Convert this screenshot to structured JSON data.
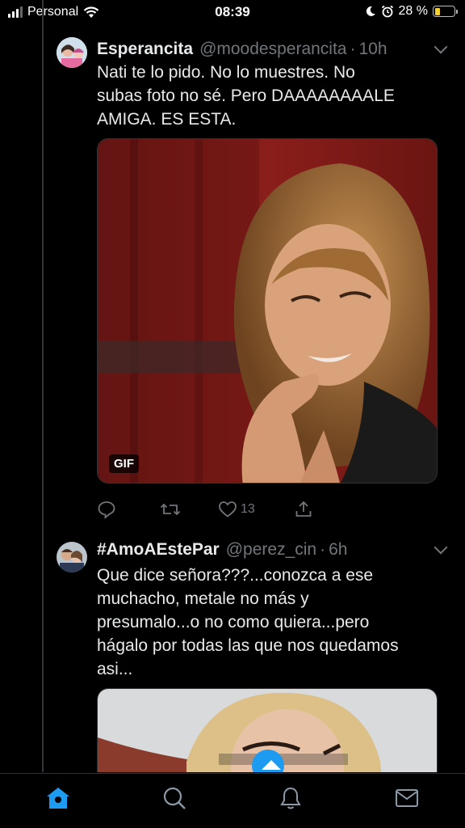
{
  "status_bar": {
    "carrier": "Personal",
    "time": "08:39",
    "battery_percent": "28 %",
    "battery_level": 0.28
  },
  "tweets": [
    {
      "name": "Esperancita",
      "handle": "@moodesperancita",
      "time": "10h",
      "text": "Nati te lo pido. No lo muestres. No\nsubas foto no sé. Pero DAAAAAAAALE\nAMIGA. ES ESTA.",
      "media_badge": "GIF",
      "like_count": "13"
    },
    {
      "name": "#AmoAEstePar",
      "handle": "@perez_cin",
      "time": "6h",
      "text": "Que dice señora???...conozca a ese\nmuchacho, metale no más y\npresumalo...o no como quiera...pero\nhágalo por todas las que nos quedamos\nasi..."
    }
  ],
  "tabbar": {
    "items": [
      "home",
      "search",
      "notifications",
      "messages"
    ]
  },
  "colors": {
    "background": "#000000",
    "text": "#e7e9ea",
    "muted": "#71767b",
    "accent": "#1d9bf0"
  }
}
